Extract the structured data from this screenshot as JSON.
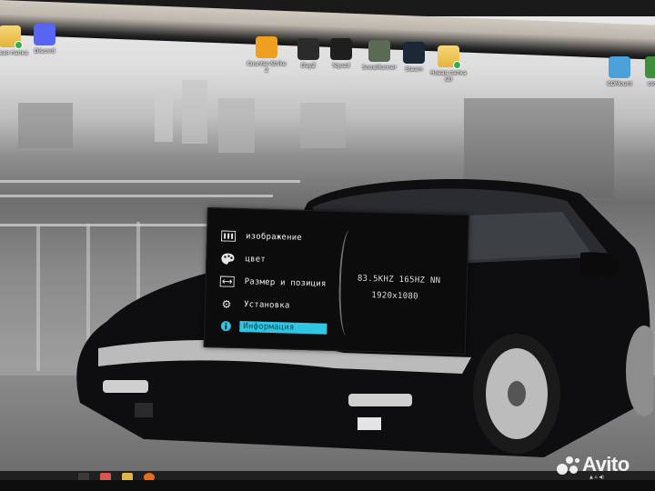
{
  "desktop": {
    "icons_left": [
      {
        "label": "Новая папка",
        "icon": "folder-icon",
        "color": "#e4b43a"
      },
      {
        "label": "Discord",
        "icon": "discord-icon",
        "color": "#5865f2"
      }
    ],
    "icons_center": [
      {
        "label": "Counter-Strike\n2",
        "icon": "counter-strike-icon",
        "color": "#f0a020"
      },
      {
        "label": "DayZ",
        "icon": "dayz-icon",
        "color": "#2b2b2b"
      },
      {
        "label": "Squad",
        "icon": "squad-icon",
        "color": "#1e1e1e"
      },
      {
        "label": "SnowRunner",
        "icon": "snowrunner-icon",
        "color": "#5a6a55"
      },
      {
        "label": "Steam",
        "icon": "steam-icon",
        "color": "#1b2838"
      },
      {
        "label": "Новая папка\n(2)",
        "icon": "folder-icon",
        "color": "#e4b43a"
      }
    ],
    "icons_right": [
      {
        "label": "CDMount",
        "icon": "cdmount-icon",
        "color": "#4aa0d8"
      },
      {
        "label": "сетно",
        "icon": "network-icon",
        "color": "#3d8f3d"
      }
    ]
  },
  "osd": {
    "menu": [
      {
        "label": "изображение",
        "icon": "picture-icon",
        "selected": false
      },
      {
        "label": "цвет",
        "icon": "palette-icon",
        "selected": false
      },
      {
        "label": "Размер и позиция",
        "icon": "size-position-icon",
        "selected": false
      },
      {
        "label": "Установка",
        "icon": "gear-icon",
        "selected": false
      },
      {
        "label": "Информация",
        "icon": "info-icon",
        "selected": true
      }
    ],
    "info": {
      "frequency": "83.5KHZ 165HZ NN",
      "resolution": "1920x1080"
    },
    "accent": "#2fc5e3"
  },
  "watermark": {
    "text": "Avito"
  },
  "taskbar": {
    "icons": [
      "windows-icon",
      "steam-icon",
      "file-explorer-icon",
      "firefox-icon"
    ]
  }
}
